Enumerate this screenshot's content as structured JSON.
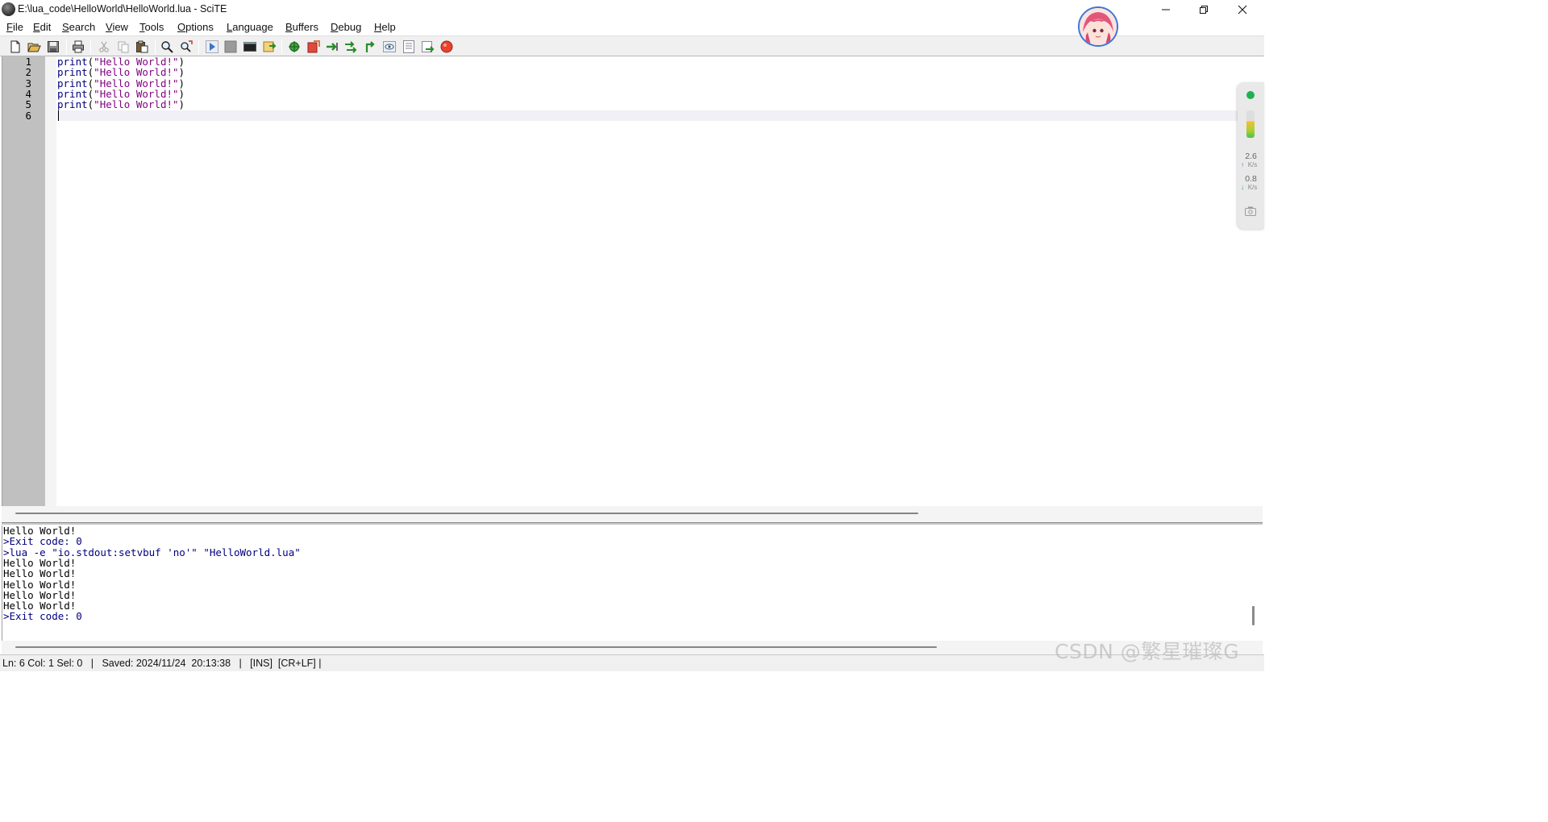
{
  "window": {
    "title": "E:\\lua_code\\HelloWorld\\HelloWorld.lua - SciTE",
    "app_icon": "scite-icon",
    "controls": [
      "minimize-icon",
      "restore-icon",
      "close-icon"
    ]
  },
  "menu": {
    "items": [
      {
        "acc": "F",
        "rest": "ile"
      },
      {
        "acc": "E",
        "rest": "dit"
      },
      {
        "acc": "S",
        "rest": "earch"
      },
      {
        "acc": "V",
        "rest": "iew"
      },
      {
        "acc": "T",
        "rest": "ools"
      },
      {
        "acc": "O",
        "rest": "ptions"
      },
      {
        "acc": "L",
        "rest": "anguage"
      },
      {
        "acc": "B",
        "rest": "uffers"
      },
      {
        "acc": "D",
        "rest": "ebug"
      },
      {
        "acc": "H",
        "rest": "elp"
      }
    ]
  },
  "toolbar": {
    "icons": [
      "new-icon",
      "open-icon",
      "save-icon",
      "print-icon",
      "cut-icon",
      "copy-icon",
      "paste-icon",
      "find-icon",
      "replace-icon",
      "run-icon",
      "stop-icon",
      "console-icon",
      "build-icon",
      "debug-bug-icon",
      "breakpoint-icon",
      "step-over-icon",
      "step-into-icon",
      "step-out-icon",
      "watch-icon",
      "locals-icon",
      "go-icon",
      "kill-icon"
    ]
  },
  "editor": {
    "line_numbers": [
      "1",
      "2",
      "3",
      "4",
      "5",
      "6"
    ],
    "lines": [
      {
        "keyword": "print",
        "open": "(",
        "string": "\"Hello World!\"",
        "close": ")"
      },
      {
        "keyword": "print",
        "open": "(",
        "string": "\"Hello World!\"",
        "close": ")"
      },
      {
        "keyword": "print",
        "open": "(",
        "string": "\"Hello World!\"",
        "close": ")"
      },
      {
        "keyword": "print",
        "open": "(",
        "string": "\"Hello World!\"",
        "close": ")"
      },
      {
        "keyword": "print",
        "open": "(",
        "string": "\"Hello World!\"",
        "close": ")"
      }
    ]
  },
  "output": {
    "lines": [
      {
        "text": "Hello World!",
        "kind": "plain"
      },
      {
        "text": ">Exit code: 0",
        "kind": "cmd"
      },
      {
        "text": ">lua -e \"io.stdout:setvbuf 'no'\" \"HelloWorld.lua\"",
        "kind": "cmd"
      },
      {
        "text": "Hello World!",
        "kind": "plain"
      },
      {
        "text": "Hello World!",
        "kind": "plain"
      },
      {
        "text": "Hello World!",
        "kind": "plain"
      },
      {
        "text": "Hello World!",
        "kind": "plain"
      },
      {
        "text": "Hello World!",
        "kind": "plain"
      },
      {
        "text": ">Exit code: 0",
        "kind": "cmd"
      }
    ]
  },
  "statusbar": {
    "text": "Ln: 6 Col: 1 Sel: 0   |   Saved: 2024/11/24  20:13:38   |   [INS]  [CR+LF] |"
  },
  "network_widget": {
    "upload_value": "2.6",
    "upload_unit": "K/s",
    "download_value": "0.8",
    "download_unit": "K/s",
    "status_color": "#20b050"
  },
  "watermark": "CSDN @繁星璀璨G",
  "colors": {
    "keyword": "#00007f",
    "string": "#7f007f",
    "output_cmd": "#00007f",
    "gutter": "#c0c0c0"
  }
}
